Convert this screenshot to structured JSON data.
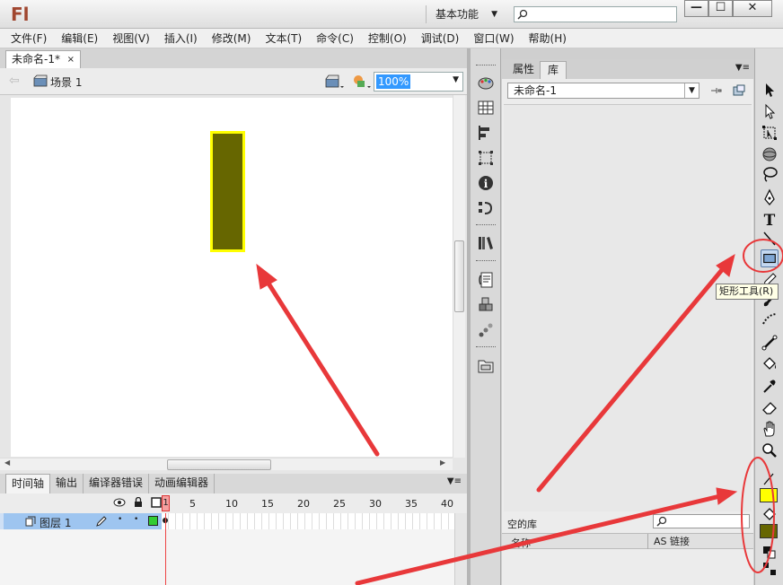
{
  "app": {
    "logo": "Fl",
    "workspace": "基本功能",
    "search_placeholder": ""
  },
  "window_controls": {
    "minimize": "—",
    "maximize": "☐",
    "close": "✕"
  },
  "menu": [
    "文件(F)",
    "编辑(E)",
    "视图(V)",
    "插入(I)",
    "修改(M)",
    "文本(T)",
    "命令(C)",
    "控制(O)",
    "调试(D)",
    "窗口(W)",
    "帮助(H)"
  ],
  "document": {
    "tab_label": "未命名-1*",
    "tab_close": "×",
    "scene": "场景 1",
    "zoom": "100%"
  },
  "stage": {
    "shape_fill": "#666600",
    "shape_stroke": "#ffff00"
  },
  "timeline": {
    "tabs": [
      "时间轴",
      "输出",
      "编译器错误",
      "动画编辑器"
    ],
    "frame_numbers": [
      "5",
      "10",
      "15",
      "20",
      "25",
      "30",
      "35",
      "40"
    ],
    "current_frame": "1",
    "layer_name": "图层 1"
  },
  "library": {
    "tabs": [
      "属性",
      "库"
    ],
    "document_select": "未命名-1",
    "empty_label": "空的库",
    "columns": {
      "name": "名称",
      "as_link": "AS 链接"
    }
  },
  "tools": {
    "tooltip": "矩形工具(R)",
    "stroke_color": "#ffff00",
    "fill_color": "#666600"
  },
  "annotation": {
    "color": "#e8383a"
  }
}
